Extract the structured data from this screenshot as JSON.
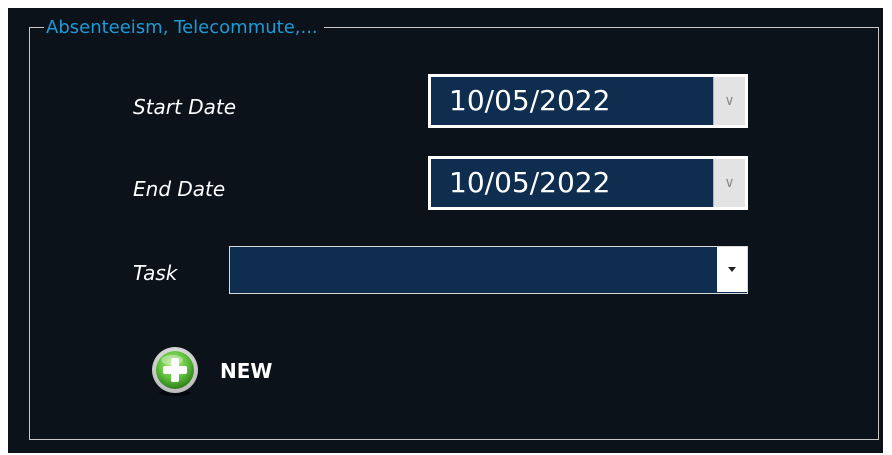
{
  "groupbox": {
    "title": "Absenteeism, Telecommute,..."
  },
  "form": {
    "start_date": {
      "label": "Start Date",
      "value": "10/05/2022",
      "toggle_icon": "chevron-down-icon"
    },
    "end_date": {
      "label": "End Date",
      "value": "10/05/2022",
      "toggle_icon": "chevron-down-icon"
    },
    "task": {
      "label": "Task",
      "value": "",
      "toggle_icon": "caret-down-icon"
    }
  },
  "actions": {
    "new_label": "NEW",
    "new_icon": "plus-circle-icon"
  },
  "colors": {
    "background": "#0b121a",
    "title": "#1e9ad6",
    "field_fill": "#0e2d4f",
    "icon_green": "#5cbf3a"
  }
}
